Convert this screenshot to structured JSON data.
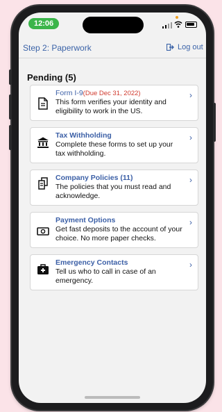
{
  "status_bar": {
    "time": "12:06"
  },
  "header": {
    "step_title": "Step 2: Paperwork",
    "logout_label": "Log out"
  },
  "section": {
    "title": "Pending (5)"
  },
  "cards": [
    {
      "title": "Form I-9",
      "due": "(Due Dec 31, 2022)",
      "description": "This form verifies your identity and eligibility to work in the US.",
      "icon": "document-icon"
    },
    {
      "title": "Tax Withholding",
      "description": "Complete these forms to set up your tax withholding.",
      "icon": "bank-icon"
    },
    {
      "title": "Company Policies (11)",
      "description": "The policies that you must read and acknowledge.",
      "icon": "documents-icon"
    },
    {
      "title": "Payment Options",
      "description": "Get fast deposits to the account of your choice. No more paper checks.",
      "icon": "money-icon"
    },
    {
      "title": "Emergency Contacts",
      "description": "Tell us who to call in case of an emergency.",
      "icon": "medical-kit-icon"
    }
  ],
  "colors": {
    "accent": "#3b63a8",
    "due": "#d03a2e",
    "time_pill": "#3bb54a",
    "page_bg": "#fbe3e8"
  }
}
